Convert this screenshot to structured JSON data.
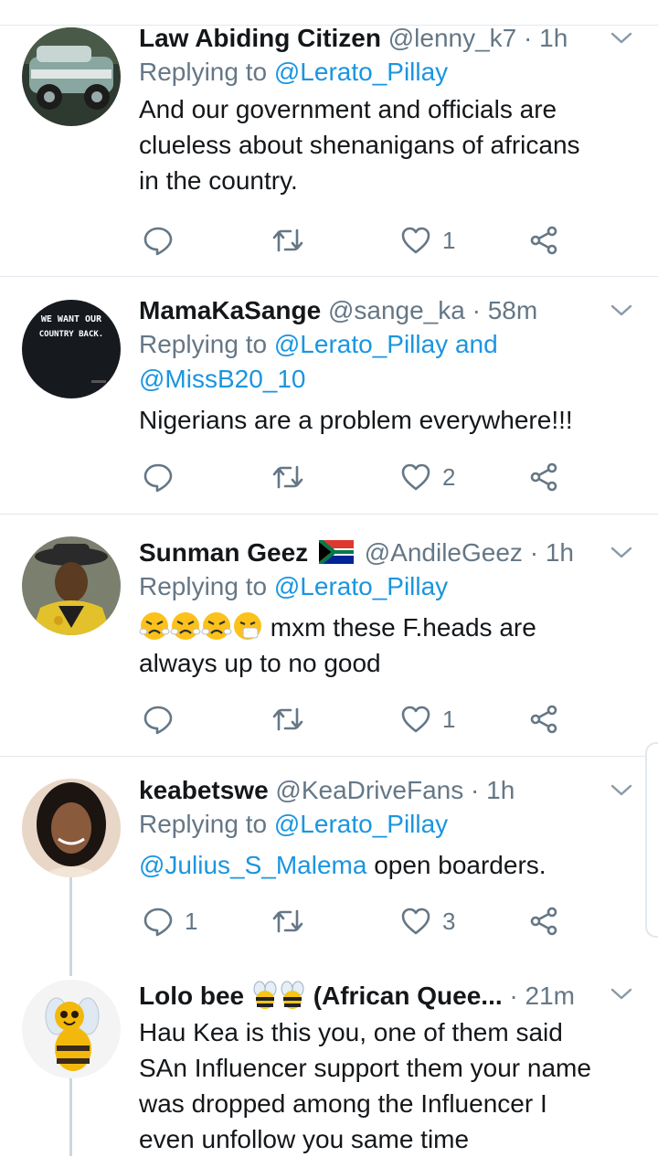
{
  "tweets": [
    {
      "name": "Law Abiding Citizen",
      "handle": "@lenny_k7",
      "dot": "·",
      "time": "1h",
      "replying_prefix": "Replying to",
      "replying_to": "@Lerato_Pillay",
      "body_lines": [
        "And our government and officials are",
        "clueless about shenanigans of africans",
        "in the country."
      ],
      "reply_count": "",
      "retweet_count": "",
      "like_count": "1"
    },
    {
      "name": "MamaKaSange",
      "handle": "@sange_ka",
      "dot": "·",
      "time": "58m",
      "replying_prefix": "Replying to",
      "replying_to": "@Lerato_Pillay and",
      "replying_to_2": "@MissB20_10",
      "body_lines": [
        "Nigerians are a problem everywhere!!!"
      ],
      "avatar_text_1": "WE WANT OUR",
      "avatar_text_2": "COUNTRY BACK.",
      "reply_count": "",
      "retweet_count": "",
      "like_count": "2"
    },
    {
      "name": "Sunman Geez",
      "handle": "@AndileGeez",
      "dot": "·",
      "time": "1h",
      "replying_prefix": "Replying to",
      "replying_to": "@Lerato_Pillay",
      "body_line_1_text": " mxm these F.heads are",
      "body_line_2": "always up to no good",
      "reply_count": "",
      "retweet_count": "",
      "like_count": "1"
    },
    {
      "name": "keabetswe",
      "handle": "@KeaDriveFans",
      "dot": "·",
      "time": "1h",
      "replying_prefix": "Replying to",
      "replying_to": "@Lerato_Pillay",
      "body_mention": "@Julius_S_Malema",
      "body_text": " open boarders.",
      "reply_count": "1",
      "retweet_count": "",
      "like_count": "3"
    },
    {
      "name": "Lolo bee",
      "name_suffix": "(African Quee...",
      "dot": "·",
      "time": "21m",
      "body_lines": [
        "Hau Kea is this you, one of them said",
        "SAn Influencer support them your name",
        "was dropped among the Influencer I",
        "even unfollow you same time"
      ]
    }
  ],
  "icons": [
    "reply-icon",
    "retweet-icon",
    "like-icon",
    "share-icon",
    "chevron-down-icon"
  ],
  "colors": {
    "link": "#1b95e0",
    "secondary": "#657786",
    "separator": "#e1e8ed",
    "text": "#14171a"
  }
}
